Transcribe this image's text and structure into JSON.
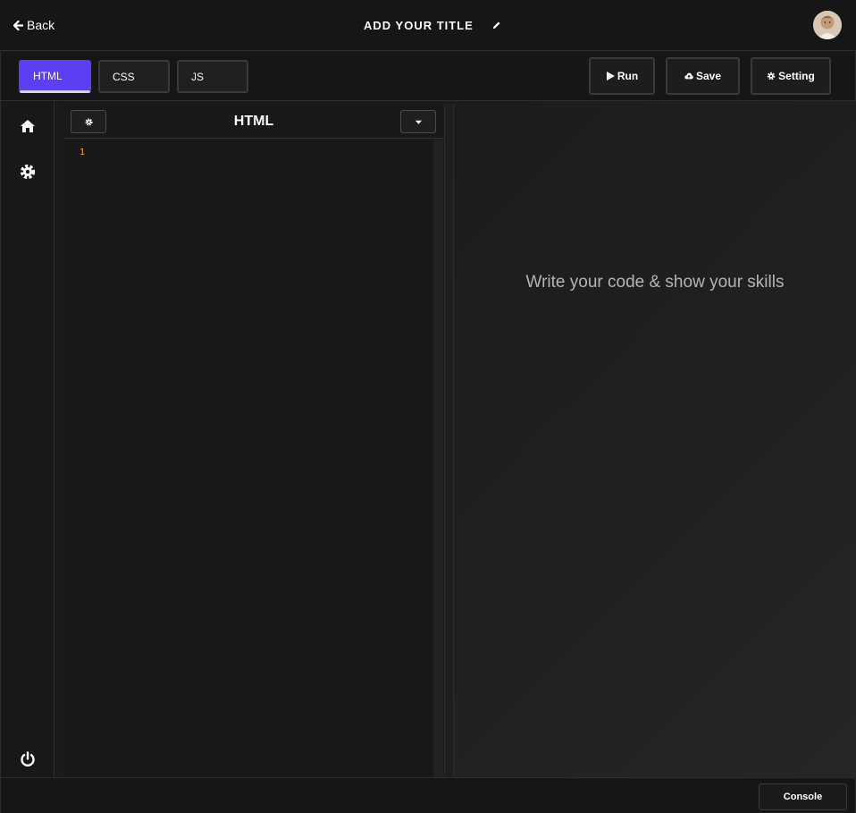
{
  "header": {
    "back_label": "Back",
    "title": "ADD YOUR TITLE",
    "back_icon": "arrow-left-icon",
    "edit_icon": "pencil-icon",
    "avatar": "user-avatar"
  },
  "toolbar": {
    "tabs": [
      {
        "label": "HTML",
        "active": true
      },
      {
        "label": "CSS",
        "active": false
      },
      {
        "label": "JS",
        "active": false
      }
    ],
    "run_label": "Run",
    "save_label": "Save",
    "setting_label": "Setting",
    "run_icon": "play-icon",
    "save_icon": "cloud-upload-icon",
    "setting_icon": "gear-icon"
  },
  "sidebar": {
    "items": [
      {
        "icon": "home-icon"
      },
      {
        "icon": "gear-icon"
      }
    ],
    "bottom_icon": "power-icon"
  },
  "editor": {
    "title": "HTML",
    "line_numbers": [
      "1"
    ],
    "settings_icon": "gear-icon",
    "dropdown_icon": "caret-down-icon"
  },
  "preview": {
    "message": "Write your code & show your skills"
  },
  "footer": {
    "console_label": "Console"
  },
  "colors": {
    "accent": "#5b3ff5",
    "line_number": "#f0b400",
    "background": "#1a1a1a"
  }
}
